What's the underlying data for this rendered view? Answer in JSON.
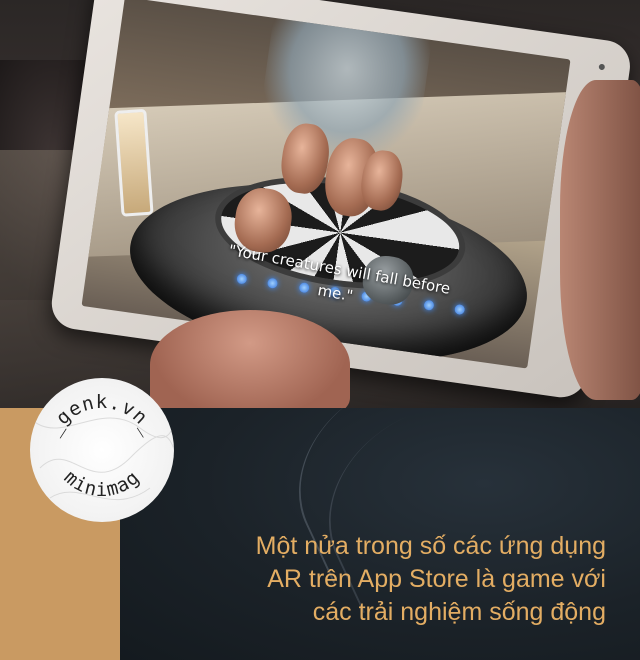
{
  "photo": {
    "ar_speech": "\"Your creatures will fall before me.\""
  },
  "badge": {
    "top_text": "_genk.vn_",
    "bottom_text": "minimag"
  },
  "caption": {
    "line1": "Một nửa trong số các ứng dụng",
    "line2": "AR trên App Store là game với",
    "line3": "các trải nghiệm sống động"
  },
  "colors": {
    "caption": "#e3ad63",
    "left_panel": "#c99a62",
    "right_panel": "#1b2228"
  }
}
